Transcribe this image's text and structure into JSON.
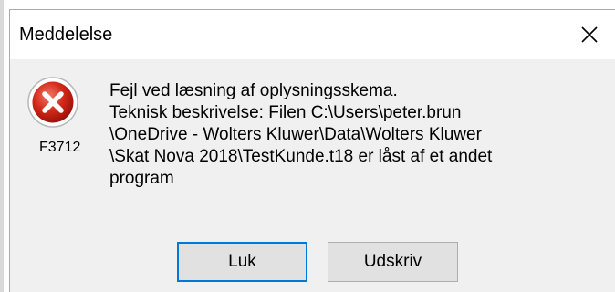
{
  "window": {
    "title": "Meddelelse",
    "close_icon": "close-icon"
  },
  "error": {
    "icon": "error-icon",
    "code": "F3712",
    "message_lines": [
      "Fejl ved læsning af oplysningsskema.",
      "Teknisk beskrivelse: Filen C:\\Users\\peter.brun",
      "\\OneDrive - Wolters Kluwer\\Data\\Wolters Kluwer",
      "\\Skat Nova 2018\\TestKunde.t18 er låst af et andet",
      "program"
    ]
  },
  "buttons": {
    "close_label": "Luk",
    "print_label": "Udskriv"
  },
  "colors": {
    "focus_border": "#0078d7",
    "icon_red": "#c42b1c",
    "dialog_bg": "#f0f0f0"
  }
}
